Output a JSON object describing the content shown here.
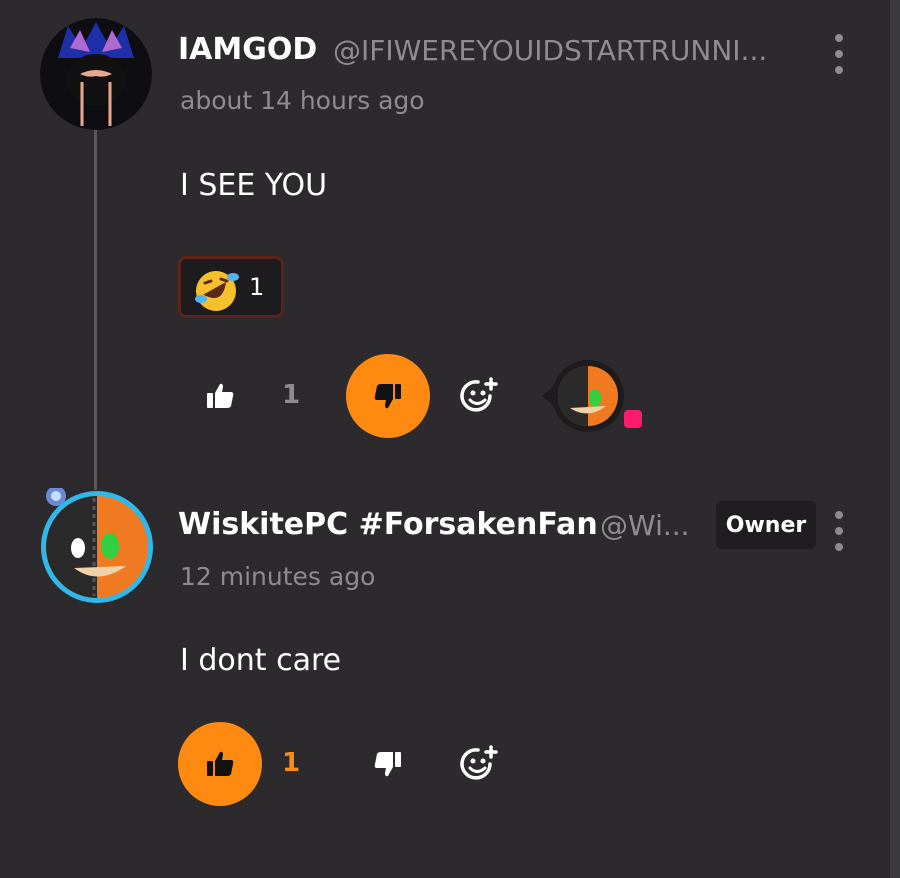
{
  "comments": [
    {
      "author_name": "IAMGOD",
      "handle": "@IFIWEREYOUIDSTARTRUNNI...",
      "timestamp": "about 14 hours ago",
      "text": "I SEE YOU",
      "reactions": [
        {
          "emoji": "rolling-on-floor-laughing",
          "count": "1"
        }
      ],
      "likes": "1",
      "liked": false,
      "disliked": true
    },
    {
      "author_name": "WiskitePC #ForsakenFan",
      "handle": "@Wi...",
      "badge": "Owner",
      "timestamp": "12 minutes ago",
      "text": "I dont care",
      "likes": "1",
      "liked": true,
      "disliked": false
    }
  ],
  "colors": {
    "background": "#2c2a2d",
    "accent": "#ff8a12",
    "muted_text": "#8e8c90",
    "notification_dot": "#ff1a6e"
  }
}
